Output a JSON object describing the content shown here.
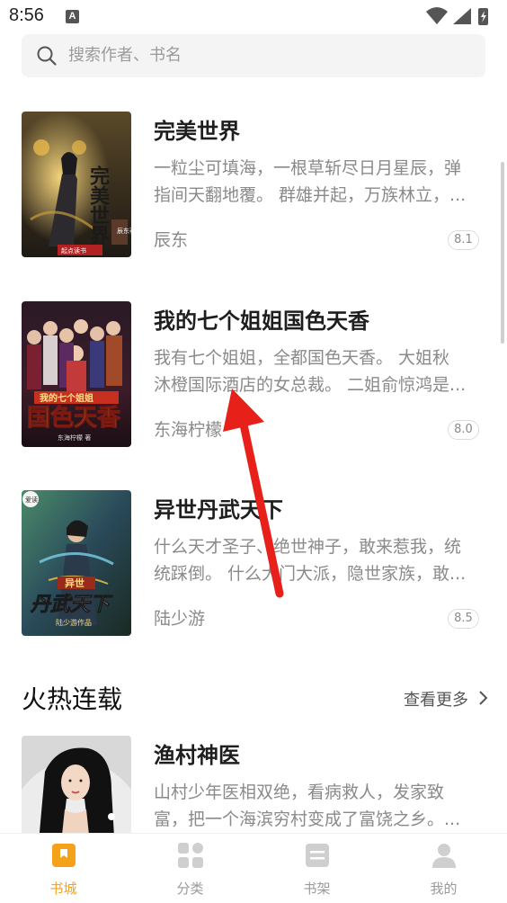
{
  "status_bar": {
    "time": "8:56"
  },
  "search": {
    "placeholder": "搜索作者、书名"
  },
  "books": [
    {
      "title": "完美世界",
      "desc_line1": "一粒尘可填海，一根草斩尽日月星辰，弹",
      "desc_line2": "指间天翻地覆。 群雄并起，万族林立，...",
      "author": "辰东",
      "score": "8.1",
      "cover_text": "完美世界",
      "cover_author": "辰东",
      "cover_publisher": "起点读书"
    },
    {
      "title": "我的七个姐姐国色天香",
      "desc_line1": "我有七个姐姐，全都国色天香。 大姐秋",
      "desc_line2": "沐橙国际酒店的女总裁。 二姐俞惊鸿是...",
      "author": "东海柠檬",
      "score": "8.0",
      "cover_text_small": "我的七个姐姐",
      "cover_text": "国色天香",
      "cover_author": "东海柠檬 著"
    },
    {
      "title": "异世丹武天下",
      "desc_line1": "什么天才圣子、绝世神子，敢来惹我，统",
      "desc_line2": "统踩倒。 什么大门大派，隐世家族，敢...",
      "author": "陆少游",
      "score": "8.5",
      "cover_text_small": "异世",
      "cover_text": "丹武天下",
      "cover_author": "陆少游作品"
    }
  ],
  "section": {
    "title": "火热连载",
    "more": "查看更多"
  },
  "hot_books": [
    {
      "title": "渔村神医",
      "desc_line1": "山村少年医相双绝，看病救人，发家致",
      "desc_line2": "富，把一个海滨穷村变成了富饶之乡。..."
    }
  ],
  "tabs": [
    {
      "label": "书城",
      "icon": "bookstore-icon",
      "active": true
    },
    {
      "label": "分类",
      "icon": "category-grid-icon",
      "active": false
    },
    {
      "label": "书架",
      "icon": "bookshelf-icon",
      "active": false
    },
    {
      "label": "我的",
      "icon": "profile-icon",
      "active": false
    }
  ],
  "colors": {
    "accent": "#f5a21b",
    "annotation_arrow": "#e8201a"
  }
}
